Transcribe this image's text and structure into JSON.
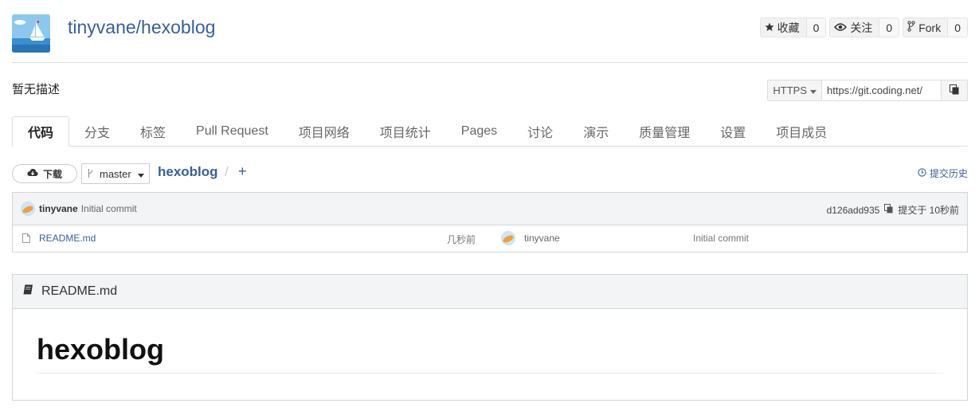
{
  "repo": {
    "title": "tinyvane/hexoblog",
    "description": "暂无描述"
  },
  "social": [
    {
      "label": "收藏",
      "count": "0",
      "icon": "star-icon"
    },
    {
      "label": "关注",
      "count": "0",
      "icon": "eye-icon"
    },
    {
      "label": "Fork",
      "count": "0",
      "icon": "fork-icon"
    }
  ],
  "clone": {
    "protocol": "HTTPS",
    "url": "https://git.coding.net/"
  },
  "tabs": [
    "代码",
    "分支",
    "标签",
    "Pull Request",
    "项目网络",
    "项目统计",
    "Pages",
    "讨论",
    "演示",
    "质量管理",
    "设置",
    "项目成员"
  ],
  "toolbar": {
    "download": "下载",
    "branch": "master",
    "breadcrumb": "hexoblog",
    "separator": "/",
    "add": "+",
    "history": "提交历史"
  },
  "commit": {
    "author": "tinyvane",
    "message": "Initial commit",
    "hash": "d126add935",
    "time": "提交于 10秒前"
  },
  "files": [
    {
      "name": "README.md",
      "age": "几秒前",
      "author": "tinyvane",
      "message": "Initial commit"
    }
  ],
  "readme": {
    "filename": "README.md",
    "heading": "hexoblog"
  },
  "colors": {
    "link": "#3a5f94",
    "border": "#dddddd",
    "panel_bg": "#f3f4f6"
  }
}
